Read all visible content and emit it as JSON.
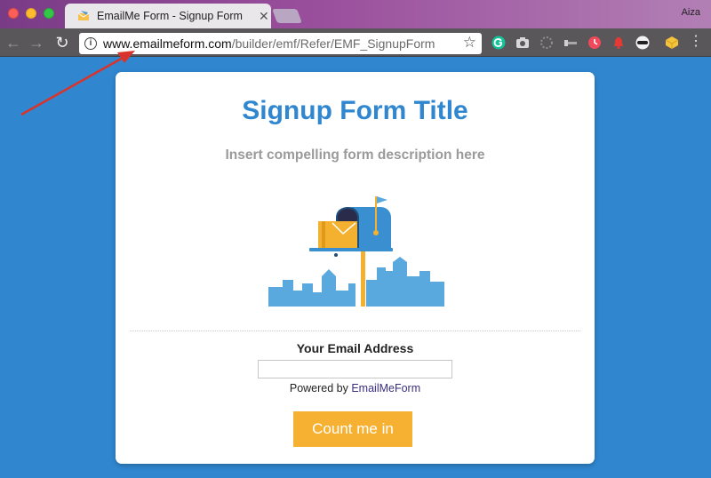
{
  "browser": {
    "tab_title": "EmailMe Form - Signup Form",
    "profile_name": "Aiza",
    "url_host": "www.emailmeform.com",
    "url_path": "/builder/emf/Refer/EMF_SignupForm"
  },
  "form": {
    "title": "Signup Form Title",
    "description": "Insert compelling form description here",
    "email_label": "Your Email Address",
    "email_value": "",
    "powered_prefix": "Powered by ",
    "powered_link": "EmailMeForm",
    "submit_label": "Count me in"
  },
  "colors": {
    "background": "#3087d0",
    "title": "#3087d0",
    "button": "#f6b133",
    "annotation_arrow": "#d9342b"
  },
  "icons": {
    "toolbar_extensions": [
      "grammarly-icon",
      "camera-icon",
      "loading-icon",
      "key-icon",
      "clock-icon",
      "bell-icon",
      "mask-icon",
      "box-icon"
    ]
  }
}
